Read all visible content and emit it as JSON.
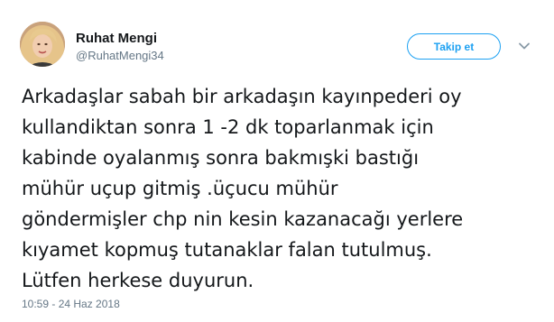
{
  "author": {
    "display_name": "Ruhat Mengi",
    "username": "@RuhatMengi34"
  },
  "follow_button": {
    "label": "Takip et"
  },
  "tweet": {
    "lines": [
      "Arkadaşlar sabah bir arkadaşın kayınpederi oy",
      "kullandiktan sonra 1 -2 dk toparlanmak için",
      "kabinde oyalanmış sonra bakmışki bastığı",
      "mühür uçup gitmiş .üçucu mühür",
      "göndermişler chp nin kesin kazanacağı yerlere",
      "kıyamet kopmuş tutanaklar falan tutulmuş.",
      "Lütfen herkese duyurun."
    ],
    "timestamp": "10:59 - 24 Haz 2018"
  },
  "icons": {
    "menu": "chevron-down-icon"
  },
  "colors": {
    "accent": "#1da1f2",
    "text": "#14171a",
    "secondary": "#657786"
  }
}
